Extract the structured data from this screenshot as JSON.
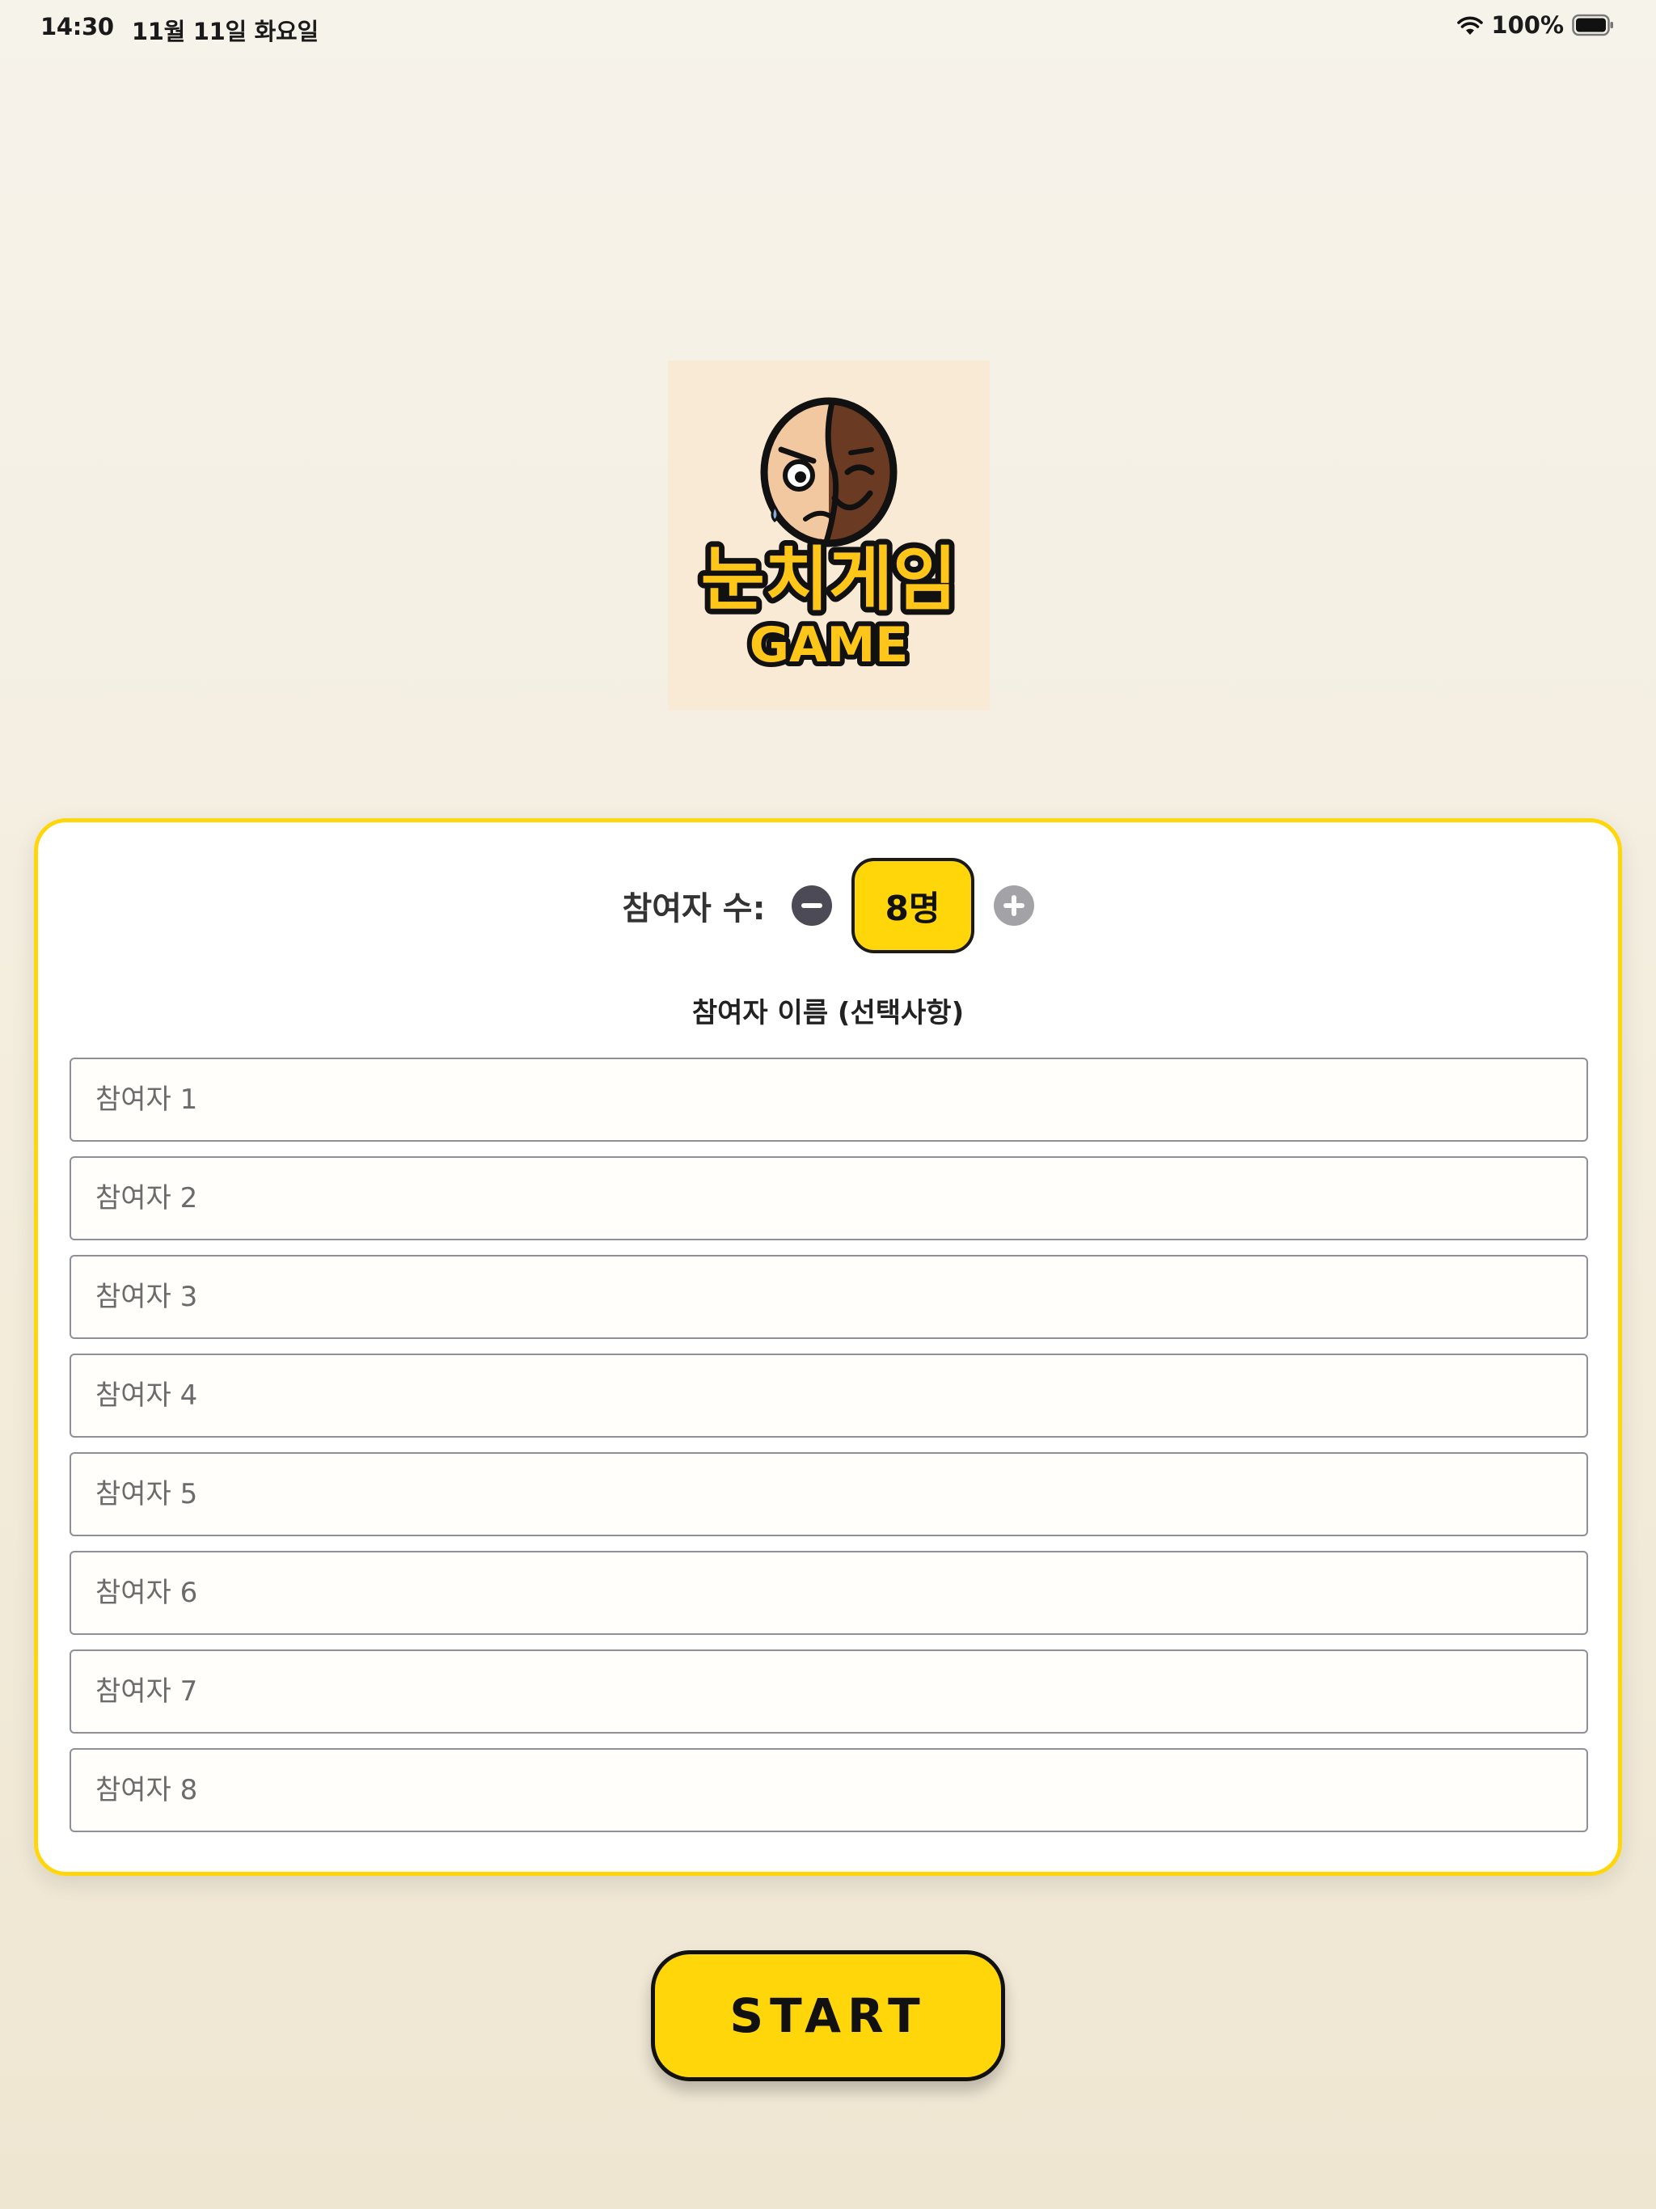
{
  "status_bar": {
    "time": "14:30",
    "date": "11월 11일 화요일",
    "battery": "100%"
  },
  "logo": {
    "title_text": "눈치게임",
    "subtitle_text": "GAME"
  },
  "participants": {
    "label": "참여자 수:",
    "count_display": "8명",
    "names_title": "참여자 이름 (선택사항)",
    "inputs": [
      {
        "placeholder": "참여자 1",
        "value": ""
      },
      {
        "placeholder": "참여자 2",
        "value": ""
      },
      {
        "placeholder": "참여자 3",
        "value": ""
      },
      {
        "placeholder": "참여자 4",
        "value": ""
      },
      {
        "placeholder": "참여자 5",
        "value": ""
      },
      {
        "placeholder": "참여자 6",
        "value": ""
      },
      {
        "placeholder": "참여자 7",
        "value": ""
      },
      {
        "placeholder": "참여자 8",
        "value": ""
      }
    ]
  },
  "start_button": {
    "label": "START"
  },
  "colors": {
    "accent": "#ffd60a",
    "dark": "#1a1a1a",
    "minus_button": "#4b4a55",
    "plus_button": "#a3a3a7"
  }
}
